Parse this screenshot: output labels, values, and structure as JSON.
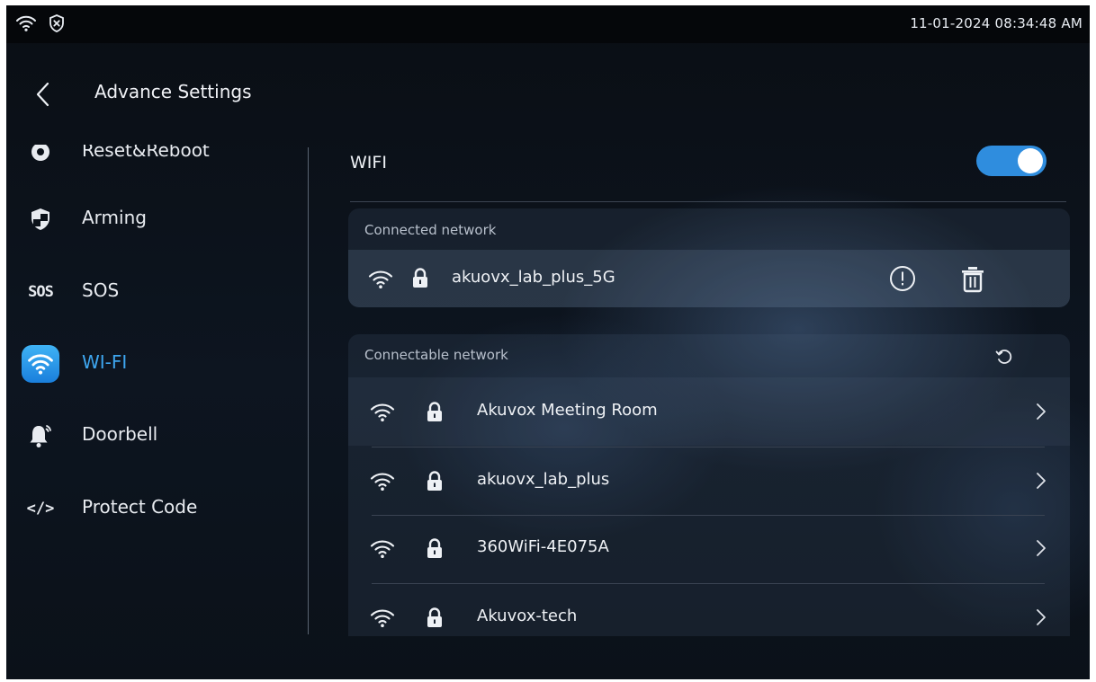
{
  "status_bar": {
    "datetime": "11-01-2024 08:34:48 AM",
    "icons": [
      "wifi-icon",
      "shield-x-icon"
    ]
  },
  "header": {
    "title": "Advance Settings",
    "back_icon": "chevron-left-icon"
  },
  "sidebar": {
    "items": [
      {
        "label": "Reset&Reboot",
        "icon": "gear-icon",
        "active": false
      },
      {
        "label": "Arming",
        "icon": "shield-icon",
        "active": false
      },
      {
        "label": "SOS",
        "icon": "sos-icon",
        "icon_text": "SOS",
        "active": false
      },
      {
        "label": "WI-FI",
        "icon": "wifi-icon",
        "active": true
      },
      {
        "label": "Doorbell",
        "icon": "bell-icon",
        "active": false
      },
      {
        "label": "Protect Code",
        "icon": "code-icon",
        "icon_text": "</>",
        "active": false
      }
    ]
  },
  "wifi": {
    "title": "WIFI",
    "enabled": true,
    "connected_header": "Connected network",
    "connected": {
      "name": "akuovx_lab_plus_5G",
      "icons": [
        "info-icon",
        "trash-icon"
      ]
    },
    "connectable_header": "Connectable network",
    "networks": [
      {
        "name": "Akuvox Meeting Room"
      },
      {
        "name": "akuovx_lab_plus"
      },
      {
        "name": "360WiFi-4E075A"
      },
      {
        "name": "Akuvox-tech"
      }
    ]
  },
  "colors": {
    "accent": "#2f8dde",
    "background": "#0b1119",
    "text": "#e8ebf0"
  }
}
